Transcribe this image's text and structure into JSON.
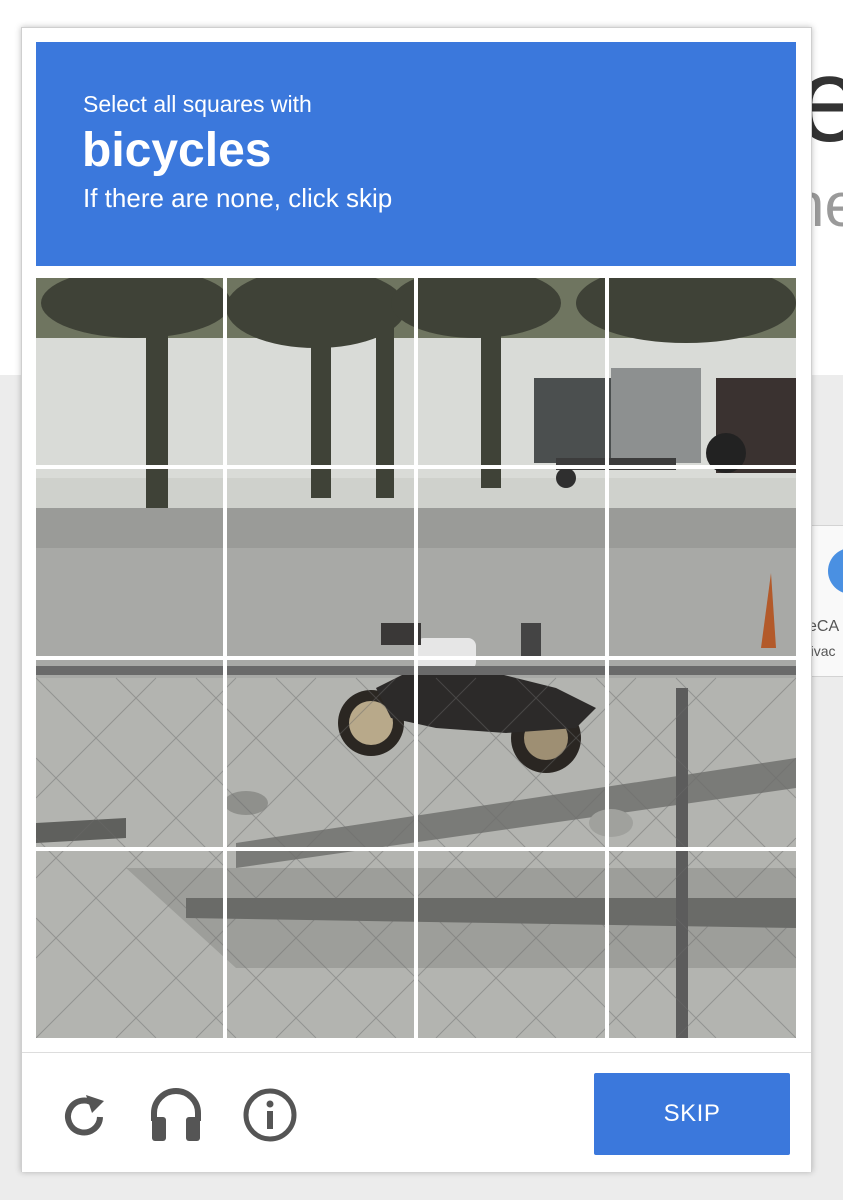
{
  "header": {
    "instruction": "Select all squares with",
    "target": "bicycles",
    "hint": "If there are none, click skip"
  },
  "grid": {
    "rows": 4,
    "cols": 4
  },
  "footer": {
    "reload_icon": "reload-icon",
    "audio_icon": "headphones-icon",
    "info_icon": "info-icon",
    "skip_label": "SKIP"
  },
  "background": {
    "big_letter": "e",
    "partial_word": "ne",
    "recaptcha_line1": "eCA",
    "recaptcha_line2": "rivac"
  },
  "colors": {
    "accent": "#3b78dc"
  }
}
